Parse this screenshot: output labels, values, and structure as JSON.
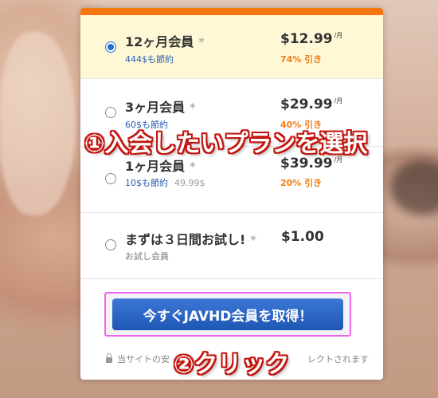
{
  "plans": [
    {
      "name": "12ヶ月会員",
      "star": "*",
      "savings": "444$も節約",
      "price": "$12.99",
      "unit": "/月",
      "discount": "74% 引き",
      "selected": true
    },
    {
      "name": "3ヶ月会員",
      "star": "*",
      "savings": "60$も節約",
      "price": "$29.99",
      "unit": "/月",
      "discount": "40% 引き",
      "selected": false
    },
    {
      "name": "1ヶ月会員",
      "star": "*",
      "savings": "10$も節約",
      "original": "49.99$",
      "price": "$39.99",
      "unit": "/月",
      "discount": "20% 引き",
      "selected": false
    },
    {
      "name": "まずは３日間お試し!",
      "star": "*",
      "price": "$1.00",
      "sub": "お試し会員",
      "selected": false
    }
  ],
  "cta": {
    "label": "今すぐJAVHD会員を取得！"
  },
  "secure_note": {
    "left": "当サイトの安",
    "right": "レクトされます"
  },
  "annotations": {
    "step1": "①入会したいプランを選択",
    "step2": "②クリック"
  },
  "colors": {
    "accent_orange": "#f6760f",
    "cta_blue": "#1f56b4",
    "selected_bg": "#fff8d6",
    "annotation_outline": "#c2140e",
    "highlight_border": "#ee66ee"
  }
}
